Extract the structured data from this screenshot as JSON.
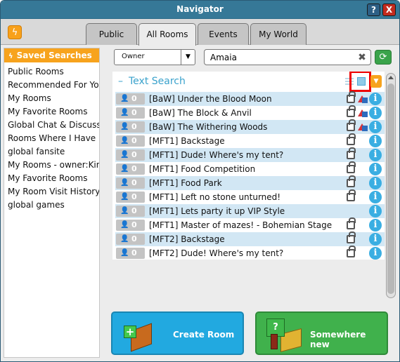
{
  "window": {
    "title": "Navigator",
    "help_label": "?",
    "close_label": "X"
  },
  "tabs": [
    {
      "label": "Public",
      "active": false
    },
    {
      "label": "All Rooms",
      "active": true
    },
    {
      "label": "Events",
      "active": false
    },
    {
      "label": "My World",
      "active": false
    }
  ],
  "sidebar": {
    "header": "Saved Searches",
    "items": [
      "Public Rooms",
      "Recommended For You",
      "My Rooms",
      "My Favorite Rooms",
      "Global Chat & Discussion",
      "Rooms Where I Have Rights",
      "global fansite",
      "My Rooms - owner:King",
      "My Favorite Rooms",
      "My Room Visit History",
      "global games"
    ]
  },
  "filter": {
    "selected": "Owner"
  },
  "search": {
    "value": "Amaia"
  },
  "results": {
    "title": "Text Search",
    "collapse_symbol": "–",
    "rooms": [
      {
        "users": "0",
        "name": "[BaW]  Under the Blood Moon",
        "locked": true,
        "group": true
      },
      {
        "users": "0",
        "name": "[BaW] The Block & Anvil",
        "locked": true,
        "group": true
      },
      {
        "users": "0",
        "name": "[BaW] The Withering Woods",
        "locked": true,
        "group": true
      },
      {
        "users": "0",
        "name": "[MFT1] Backstage",
        "locked": true,
        "group": false
      },
      {
        "users": "0",
        "name": "[MFT1] Dude! Where's my tent?",
        "locked": true,
        "group": false
      },
      {
        "users": "0",
        "name": "[MFT1] Food Competition",
        "locked": true,
        "group": false
      },
      {
        "users": "0",
        "name": "[MFT1] Food Park",
        "locked": true,
        "group": false
      },
      {
        "users": "0",
        "name": "[MFT1] Left no stone unturned!",
        "locked": true,
        "group": false
      },
      {
        "users": "0",
        "name": "[MFT1] Lets party it up VIP Style",
        "locked": false,
        "group": false
      },
      {
        "users": "0",
        "name": "[MFT1] Master of mazes! - Bohemian Stage",
        "locked": true,
        "group": false
      },
      {
        "users": "0",
        "name": "[MFT2] Backstage",
        "locked": true,
        "group": false
      },
      {
        "users": "0",
        "name": "[MFT2] Dude! Where's my tent?",
        "locked": true,
        "group": false
      }
    ]
  },
  "buttons": {
    "create_room": "Create Room",
    "somewhere_new": "Somewhere new"
  },
  "colors": {
    "titlebar": "#367897",
    "accent_orange": "#f7a31d",
    "row_alt": "#d2e7f4",
    "create_button": "#22a9e0",
    "somewhere_button": "#40b14c",
    "highlight": "#ee0000"
  }
}
